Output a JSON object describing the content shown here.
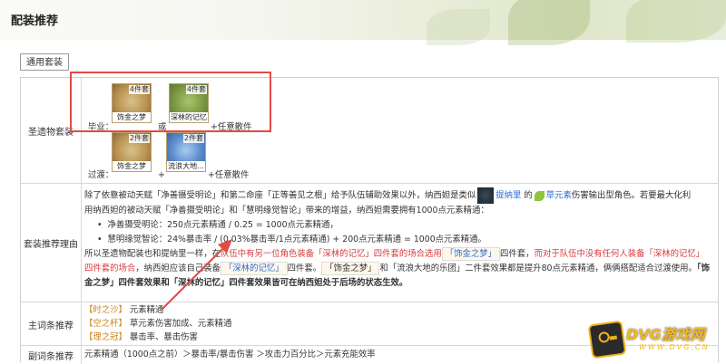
{
  "page": {
    "title": "配装推荐",
    "tab_label": "通用套装"
  },
  "colors": {
    "accent_red": "#d9383a",
    "accent_gold": "#c9871d",
    "link_blue": "#2a6ad5",
    "highlight_box": "#e24a44"
  },
  "artifact_row": {
    "label": "圣遗物套装",
    "best_label": "毕业：",
    "or_text": "或",
    "best_sets": [
      {
        "name": "饰金之梦",
        "badge": "4件套"
      },
      {
        "name": "深林的记忆",
        "badge": "4件套"
      }
    ],
    "best_suffix": "+任意散件",
    "transition_label": "过渡：",
    "transition_sets": [
      {
        "name": "饰金之梦",
        "badge": "2件套"
      },
      {
        "name": "流浪大地...",
        "badge": "2件套"
      }
    ],
    "transition_suffix": "+任意散件"
  },
  "reason_row": {
    "label": "套装推荐理由",
    "line1_a": "除了依靠被动天赋「净善摄受明论」和第二命座「正等善见之根」给予队伍辅助效果以外，纳西妲是类似",
    "line1_link": "提纳里",
    "line1_b": "的",
    "line1_element": "草元素",
    "line1_c": "伤害输出型角色。若要最大化利",
    "line2": "用纳西妲的被动天赋「净善摄受明论」和「慧明缘觉智论」带来的增益，纳西妲需要拥有1000点元素精通：",
    "bullet1": "净善摄受明论：250点元素精通 / 0.25 = 1000点元素精通，",
    "bullet2": "慧明缘觉智论：24%暴击率 / (0.03%暴击率/1点元素精通) + 200点元素精通 = 1000点元素精通。",
    "line3_a": "所以圣遗物配装也和提纳里一样，在",
    "line3_red1": "队伍中有另一位角色装备「深林的记忆」四件套的场合选用",
    "line3_tag": "「饰金之梦」",
    "line3_b": "四件套，",
    "line3_red2": "而对于队伍中没有任何人装备「深林的记忆」",
    "line4_red": "四件套的场合",
    "line4_a": "，纳西妲应该自己装备",
    "line4_tag1": "「深林的记忆」",
    "line4_b": "四件套。",
    "line4_tag2": "「饰金之梦」",
    "line4_c": "和「流浪大地的乐团」二件套效果都是提升80点元素精通，俩俩搭配适合过渡使用。",
    "line4_bold": "「饰",
    "line5_bold": "金之梦」四件套效果和「深林的记忆」四件套效果皆可在纳西妲处于后场的状态生效。"
  },
  "main_stat_row": {
    "label": "主词条推荐",
    "items": [
      {
        "slot": "【时之沙】",
        "stat": "元素精通"
      },
      {
        "slot": "【空之杯】",
        "stat": "草元素伤害加成、元素精通"
      },
      {
        "slot": "【理之冠】",
        "stat": "暴击率、暴击伤害"
      }
    ]
  },
  "sub_stat_row": {
    "label": "副词条推荐",
    "text": "元素精通（1000点之前）＞暴击率/暴击伤害 ＞攻击力百分比＞元素充能效率"
  },
  "watermark": {
    "brand": "DVG游戏网",
    "domain": "WWW.DVG.CN",
    "icon": "gamepad-icon"
  }
}
